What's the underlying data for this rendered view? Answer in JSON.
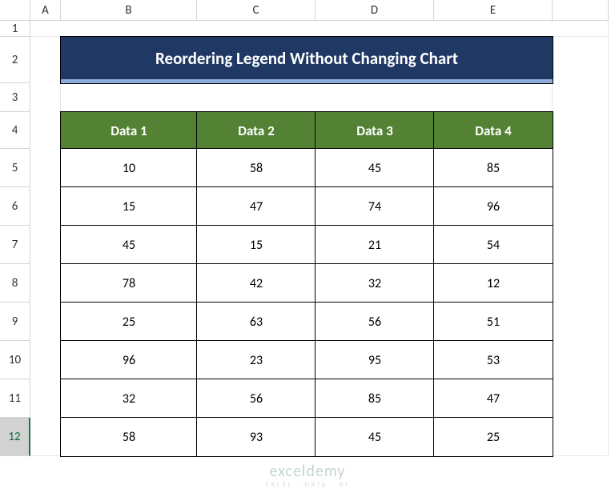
{
  "columns": [
    "A",
    "B",
    "C",
    "D",
    "E"
  ],
  "rows": [
    "1",
    "2",
    "3",
    "4",
    "5",
    "6",
    "7",
    "8",
    "9",
    "10",
    "11",
    "12"
  ],
  "selected_row": "12",
  "title": "Reordering Legend Without Changing Chart",
  "table": {
    "headers": [
      "Data 1",
      "Data 2",
      "Data 3",
      "Data 4"
    ],
    "rows": [
      [
        10,
        58,
        45,
        85
      ],
      [
        15,
        47,
        74,
        96
      ],
      [
        45,
        15,
        21,
        54
      ],
      [
        78,
        42,
        32,
        12
      ],
      [
        25,
        63,
        56,
        51
      ],
      [
        96,
        23,
        95,
        53
      ],
      [
        32,
        56,
        85,
        47
      ],
      [
        58,
        93,
        45,
        25
      ]
    ]
  },
  "watermark": {
    "brand": "exceldemy",
    "tagline": "EXCEL · DATA · BI"
  },
  "chart_data": {
    "type": "table",
    "title": "Reordering Legend Without Changing Chart",
    "series": [
      {
        "name": "Data 1",
        "values": [
          10,
          15,
          45,
          78,
          25,
          96,
          32,
          58
        ]
      },
      {
        "name": "Data 2",
        "values": [
          58,
          47,
          15,
          42,
          63,
          23,
          56,
          93
        ]
      },
      {
        "name": "Data 3",
        "values": [
          45,
          74,
          21,
          32,
          56,
          95,
          85,
          45
        ]
      },
      {
        "name": "Data 4",
        "values": [
          85,
          96,
          54,
          12,
          51,
          53,
          47,
          25
        ]
      }
    ]
  }
}
